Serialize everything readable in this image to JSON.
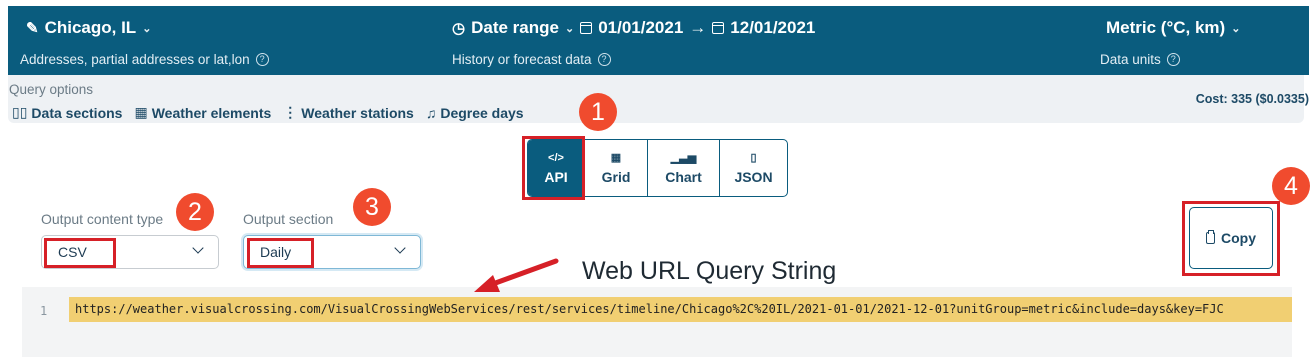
{
  "header": {
    "location": "Chicago, IL",
    "location_hint": "Addresses, partial addresses or lat,lon",
    "date_range_label": "Date range",
    "date_start": "01/01/2021",
    "date_end": "12/01/2021",
    "date_hint": "History or forecast data",
    "units": "Metric (°C, km)",
    "units_hint": "Data units"
  },
  "query_options": {
    "label": "Query options",
    "items": [
      "Data sections",
      "Weather elements",
      "Weather stations",
      "Degree days"
    ],
    "cost": "Cost: 335 ($0.0335)"
  },
  "view_tabs": [
    {
      "label": "API",
      "icon": "code-icon",
      "active": true
    },
    {
      "label": "Grid",
      "icon": "grid-icon",
      "active": false
    },
    {
      "label": "Chart",
      "icon": "bar-chart-icon",
      "active": false
    },
    {
      "label": "JSON",
      "icon": "file-icon",
      "active": false
    }
  ],
  "output": {
    "content_type_label": "Output content type",
    "content_type_value": "CSV",
    "section_label": "Output section",
    "section_value": "Daily"
  },
  "copy_label": "Copy",
  "code": {
    "line_number": "1",
    "url": "https://weather.visualcrossing.com/VisualCrossingWebServices/rest/services/timeline/Chicago%2C%20IL/2021-01-01/2021-12-01?unitGroup=metric&include=days&key=FJC"
  },
  "annotations": {
    "caption": "Web URL Query String",
    "badges": [
      "1",
      "2",
      "3",
      "4"
    ],
    "highlight_color": "#d62027",
    "badge_color": "#f04b2e"
  },
  "colors": {
    "brand": "#0a5c7e",
    "code_highlight": "#f1cf72"
  }
}
